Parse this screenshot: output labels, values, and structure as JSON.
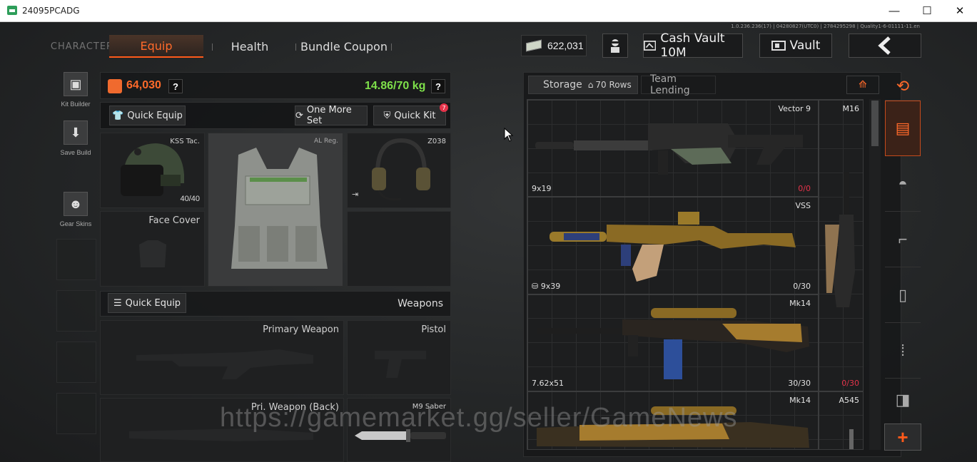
{
  "window": {
    "title": "24095PCADG",
    "minimize": "—",
    "maximize": "☐",
    "close": "✕"
  },
  "version": "1.0.236.236(17) | 04280827(UTC0) | 2784295298 | Quality1-6-01111-11.en",
  "tabs": {
    "character": "CHARACTER",
    "equip": "Equip",
    "health": "Health",
    "bundle": "Bundle Coupon"
  },
  "top": {
    "money": "622,031",
    "cash_vault": "Cash Vault 10M",
    "vault": "Vault"
  },
  "sidebar": {
    "kit_builder": "Kit Builder",
    "save_build": "Save Build",
    "gear_skins": "Gear Skins"
  },
  "equip": {
    "value": "64,030",
    "weight": "14.86/70 kg",
    "help": "?",
    "quick_equip": "Quick Equip",
    "one_more_set": "One More Set",
    "quick_kit": "Quick Kit",
    "quick_kit_badge": "7",
    "helmet_name": "KSS Tac.",
    "helmet_dur": "40/40",
    "armor_name": "AL Reg.",
    "headset_name": "Z038",
    "face_cover": "Face Cover"
  },
  "weapons": {
    "quick_equip": "Quick Equip",
    "header": "Weapons",
    "primary": "Primary Weapon",
    "pistol": "Pistol",
    "primary_back": "Pri. Weapon (Back)",
    "melee": "M9 Saber"
  },
  "storage": {
    "tab": "Storage",
    "rows": "70 Rows",
    "team_lending": "Team Lending",
    "items": [
      {
        "name": "Vector 9",
        "caliber": "9x19",
        "ammo": "0/0"
      },
      {
        "name": "VSS",
        "caliber": "9x39",
        "ammo": "0/30"
      },
      {
        "name": "Mk14",
        "caliber": "7.62x51",
        "ammo": "30/30"
      },
      {
        "name": "Mk14",
        "caliber": "",
        "ammo": ""
      }
    ],
    "side_items": [
      {
        "name": "M16",
        "ammo": "0/30"
      },
      {
        "name": "A545",
        "ammo": ""
      }
    ]
  },
  "watermark": "https://gamemarket.gg/seller/GameNews",
  "colors": {
    "accent": "#ff5a1a",
    "weight_green": "#7ee04a",
    "ammo_red": "#e5334a"
  }
}
